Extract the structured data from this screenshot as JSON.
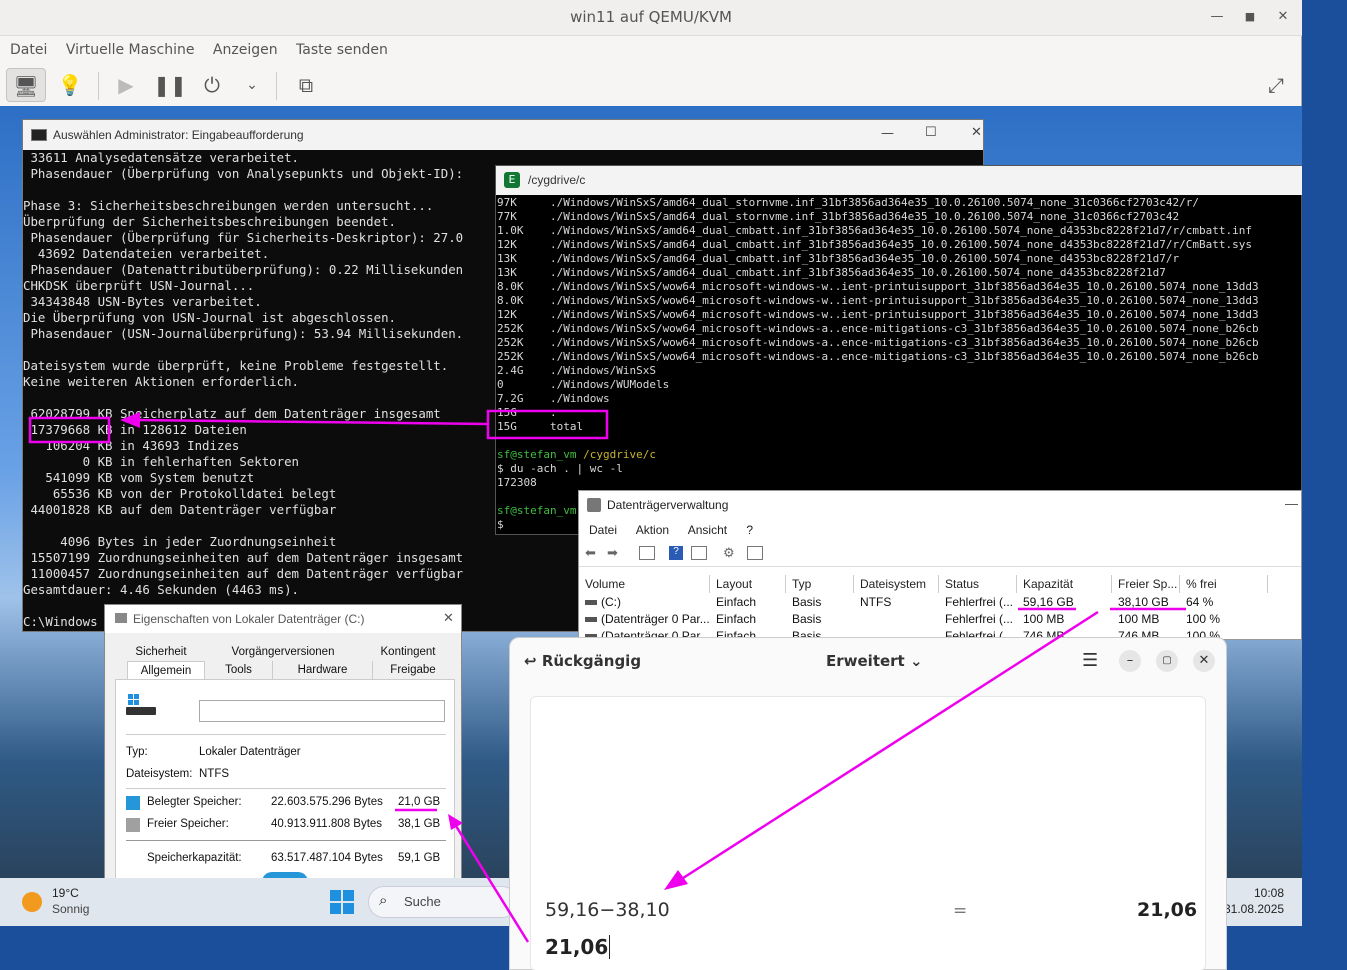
{
  "vm": {
    "title": "win11 auf QEMU/KVM",
    "menu": [
      "Datei",
      "Virtuelle Maschine",
      "Anzeigen",
      "Taste senden"
    ]
  },
  "cmd": {
    "title": "Auswählen Administrator: Eingabeaufforderung",
    "lines": [
      " 33611 Analysedatensätze verarbeitet.",
      " Phasendauer (Überprüfung von Analysepunkts und Objekt-ID):",
      "",
      "Phase 3: Sicherheitsbeschreibungen werden untersucht...",
      "Überprüfung der Sicherheitsbeschreibungen beendet.",
      " Phasendauer (Überprüfung für Sicherheits-Deskriptor): 27.0",
      "  43692 Datendateien verarbeitet.",
      " Phasendauer (Datenattributüberprüfung): 0.22 Millisekunden",
      "CHKDSK überprüft USN-Journal...",
      " 34343848 USN-Bytes verarbeitet.",
      "Die Überprüfung von USN-Journal ist abgeschlossen.",
      " Phasendauer (USN-Journalüberprüfung): 53.94 Millisekunden.",
      "",
      "Dateisystem wurde überprüft, keine Probleme festgestellt.",
      "Keine weiteren Aktionen erforderlich.",
      "",
      " 62028799 KB Speicherplatz auf dem Datenträger insgesamt",
      " 17379668 KB in 128612 Dateien",
      "   106204 KB in 43693 Indizes",
      "        0 KB in fehlerhaften Sektoren",
      "   541099 KB vom System benutzt",
      "    65536 KB von der Protokolldatei belegt",
      " 44001828 KB auf dem Datenträger verfügbar",
      "",
      "     4096 Bytes in jeder Zuordnungseinheit",
      " 15507199 Zuordnungseinheiten auf dem Datenträger insgesamt",
      " 11000457 Zuordnungseinheiten auf dem Datenträger verfügbar",
      "Gesamtdauer: 4.46 Sekunden (4463 ms).",
      "",
      "C:\\Windows"
    ]
  },
  "cygwin": {
    "title": "/cygdrive/c",
    "lines": [
      "97K     ./Windows/WinSxS/amd64_dual_stornvme.inf_31bf3856ad364e35_10.0.26100.5074_none_31c0366cf2703c42/r/",
      "77K     ./Windows/WinSxS/amd64_dual_stornvme.inf_31bf3856ad364e35_10.0.26100.5074_none_31c0366cf2703c42",
      "1.0K    ./Windows/WinSxS/amd64_dual_cmbatt.inf_31bf3856ad364e35_10.0.26100.5074_none_d4353bc8228f21d7/r/cmbatt.inf",
      "12K     ./Windows/WinSxS/amd64_dual_cmbatt.inf_31bf3856ad364e35_10.0.26100.5074_none_d4353bc8228f21d7/r/CmBatt.sys",
      "13K     ./Windows/WinSxS/amd64_dual_cmbatt.inf_31bf3856ad364e35_10.0.26100.5074_none_d4353bc8228f21d7/r",
      "13K     ./Windows/WinSxS/amd64_dual_cmbatt.inf_31bf3856ad364e35_10.0.26100.5074_none_d4353bc8228f21d7",
      "8.0K    ./Windows/WinSxS/wow64_microsoft-windows-w..ient-printuisupport_31bf3856ad364e35_10.0.26100.5074_none_13dd3",
      "8.0K    ./Windows/WinSxS/wow64_microsoft-windows-w..ient-printuisupport_31bf3856ad364e35_10.0.26100.5074_none_13dd3",
      "12K     ./Windows/WinSxS/wow64_microsoft-windows-w..ient-printuisupport_31bf3856ad364e35_10.0.26100.5074_none_13dd3",
      "252K    ./Windows/WinSxS/wow64_microsoft-windows-a..ence-mitigations-c3_31bf3856ad364e35_10.0.26100.5074_none_b26cb",
      "252K    ./Windows/WinSxS/wow64_microsoft-windows-a..ence-mitigations-c3_31bf3856ad364e35_10.0.26100.5074_none_b26cb",
      "252K    ./Windows/WinSxS/wow64_microsoft-windows-a..ence-mitigations-c3_31bf3856ad364e35_10.0.26100.5074_none_b26cb",
      "2.4G    ./Windows/WinSxS",
      "0       ./Windows/WUModels",
      "7.2G    ./Windows",
      "15G     .",
      "15G     total"
    ],
    "prompt1_user": "sf@stefan_vm",
    "prompt1_path": "/cygdrive/c",
    "cmd_line": "$ du -ach . | wc -l",
    "result": "172308",
    "prompt2_user": "sf@stefan_vm",
    "prompt2_tail": "$ "
  },
  "disk": {
    "title": "Datenträgerverwaltung",
    "menu": [
      "Datei",
      "Aktion",
      "Ansicht",
      "?"
    ],
    "headers": [
      "Volume",
      "Layout",
      "Typ",
      "Dateisystem",
      "Status",
      "Kapazität",
      "Freier Sp...",
      "% frei"
    ],
    "rows": [
      [
        "(C:)",
        "Einfach",
        "Basis",
        "NTFS",
        "Fehlerfrei (...",
        "59,16 GB",
        "38,10 GB",
        "64 %"
      ],
      [
        "(Datenträger 0 Par...",
        "Einfach",
        "Basis",
        "",
        "Fehlerfrei (...",
        "100 MB",
        "100 MB",
        "100 %"
      ],
      [
        "(Datenträger 0 Par...",
        "Einfach",
        "Basis",
        "",
        "Fehlerfrei (...",
        "746 MB",
        "746 MB",
        "100 %"
      ]
    ]
  },
  "props": {
    "title": "Eigenschaften von Lokaler Datenträger (C:)",
    "tabs_row1": [
      "Sicherheit",
      "Vorgängerversionen",
      "Kontingent"
    ],
    "tabs_row2": [
      "Allgemein",
      "Tools",
      "Hardware",
      "Freigabe"
    ],
    "type_label": "Typ:",
    "type_value": "Lokaler Datenträger",
    "fs_label": "Dateisystem:",
    "fs_value": "NTFS",
    "used_label": "Belegter Speicher:",
    "used_bytes": "22.603.575.296 Bytes",
    "used_gb": "21,0 GB",
    "free_label": "Freier Speicher:",
    "free_bytes": "40.913.911.808 Bytes",
    "free_gb": "38,1 GB",
    "cap_label": "Speicherkapazität:",
    "cap_bytes": "63.517.487.104 Bytes",
    "cap_gb": "59,1 GB",
    "used_color": "#2596d8",
    "free_color": "#a0a0a0"
  },
  "taskbar": {
    "temp": "19°C",
    "weather": "Sonnig",
    "search": "Suche",
    "time": "10:08",
    "date": "31.08.2025"
  },
  "calc": {
    "back_label": "Rückgängig",
    "mode": "Erweitert",
    "expression": "59,16−38,10",
    "equals": "=",
    "result": "21,06",
    "input": "21,06"
  }
}
